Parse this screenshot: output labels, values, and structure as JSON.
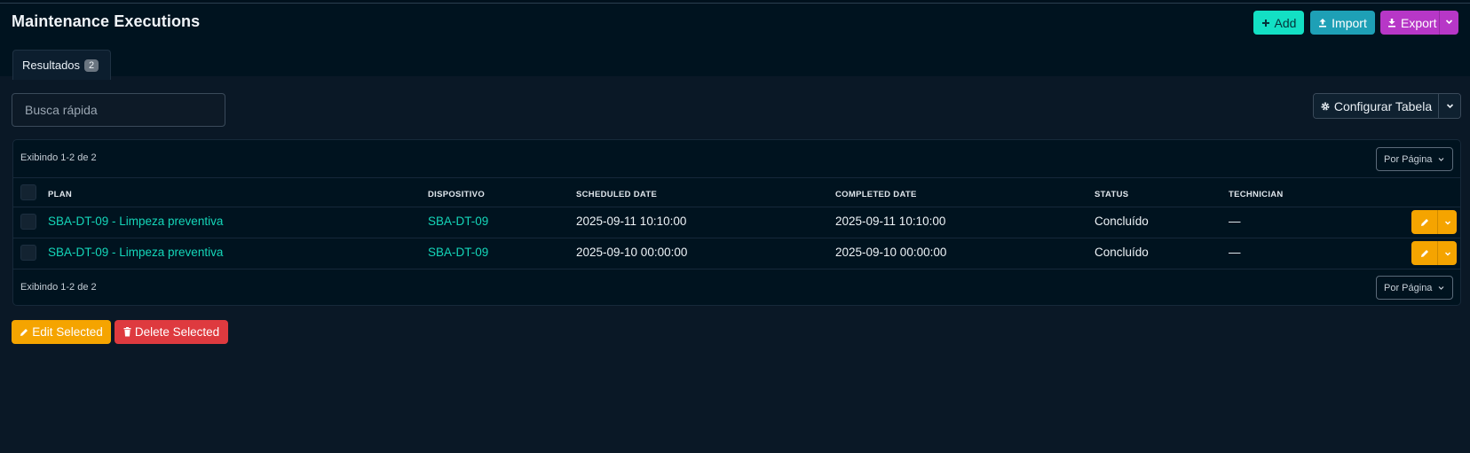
{
  "page": {
    "title": "Maintenance Executions"
  },
  "toolbar": {
    "add_label": "Add",
    "import_label": "Import",
    "export_label": "Export"
  },
  "tabs": [
    {
      "label": "Resultados",
      "count": "2"
    }
  ],
  "search": {
    "placeholder": "Busca rápida",
    "value": ""
  },
  "table_config": {
    "label": "Configurar Tabela"
  },
  "pagination": {
    "top_text": "Exibindo 1-2 de 2",
    "bottom_text": "Exibindo 1-2 de 2",
    "per_page_label": "Por Página"
  },
  "table": {
    "columns": [
      "PLAN",
      "DISPOSITIVO",
      "SCHEDULED DATE",
      "COMPLETED DATE",
      "STATUS",
      "TECHNICIAN"
    ],
    "rows": [
      {
        "plan": "SBA-DT-09 - Limpeza preventiva",
        "device": "SBA-DT-09",
        "scheduled": "2025-09-11 10:10:00",
        "completed": "2025-09-11 10:10:00",
        "status": "Concluído",
        "technician": "—"
      },
      {
        "plan": "SBA-DT-09 - Limpeza preventiva",
        "device": "SBA-DT-09",
        "scheduled": "2025-09-10 00:00:00",
        "completed": "2025-09-10 00:00:00",
        "status": "Concluído",
        "technician": "—"
      }
    ]
  },
  "bulk": {
    "edit_label": "Edit Selected",
    "delete_label": "Delete Selected"
  },
  "colors": {
    "background": "#0a1826",
    "accent_teal": "#13e0c4",
    "import_blue": "#1ea0b6",
    "export_purple": "#b737c7",
    "warning_orange": "#f5a400",
    "danger_red": "#de3a3f",
    "link_teal": "#14d6b9"
  },
  "icons": {
    "add": "plus-icon",
    "import": "upload-icon",
    "export": "download-icon",
    "config": "gear-icon",
    "edit": "pencil-icon",
    "delete": "trash-icon",
    "dropdown": "chevron-down-icon"
  }
}
